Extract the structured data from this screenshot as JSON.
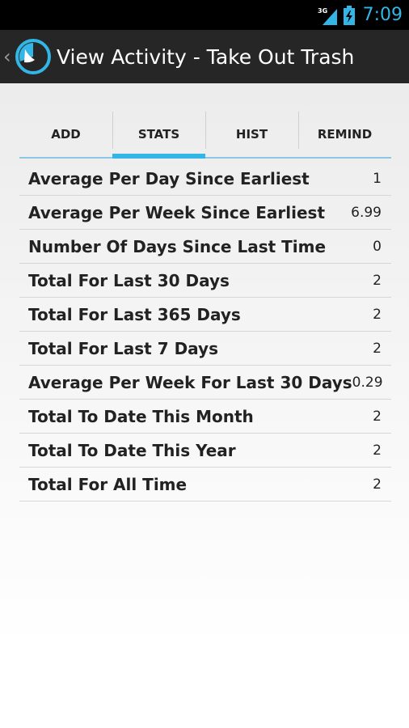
{
  "status_bar": {
    "network": "3G",
    "time": "7:09"
  },
  "action_bar": {
    "up_icon": "chevron-left-icon",
    "app_icon": "clock-icon",
    "title": "View Activity - Take Out Trash"
  },
  "tabs": [
    {
      "label": "ADD",
      "active": false
    },
    {
      "label": "STATS",
      "active": true
    },
    {
      "label": "HIST",
      "active": false
    },
    {
      "label": "REMIND",
      "active": false
    }
  ],
  "stats": [
    {
      "label": "Average Per Day Since Earliest",
      "value": "1"
    },
    {
      "label": "Average Per Week Since Earliest",
      "value": "6.99"
    },
    {
      "label": "Number Of Days Since Last Time",
      "value": "0"
    },
    {
      "label": "Total For Last 30 Days",
      "value": "2"
    },
    {
      "label": "Total For Last 365 Days",
      "value": "2"
    },
    {
      "label": "Total For Last 7 Days",
      "value": "2"
    },
    {
      "label": "Average Per Week For Last 30 Days",
      "value": "0.29"
    },
    {
      "label": "Total To Date This Month",
      "value": "2"
    },
    {
      "label": "Total To Date This Year",
      "value": "2"
    },
    {
      "label": "Total For All Time",
      "value": "2"
    }
  ],
  "colors": {
    "accent": "#33b5e5",
    "action_bar": "#262626",
    "status_bar": "#000000"
  }
}
